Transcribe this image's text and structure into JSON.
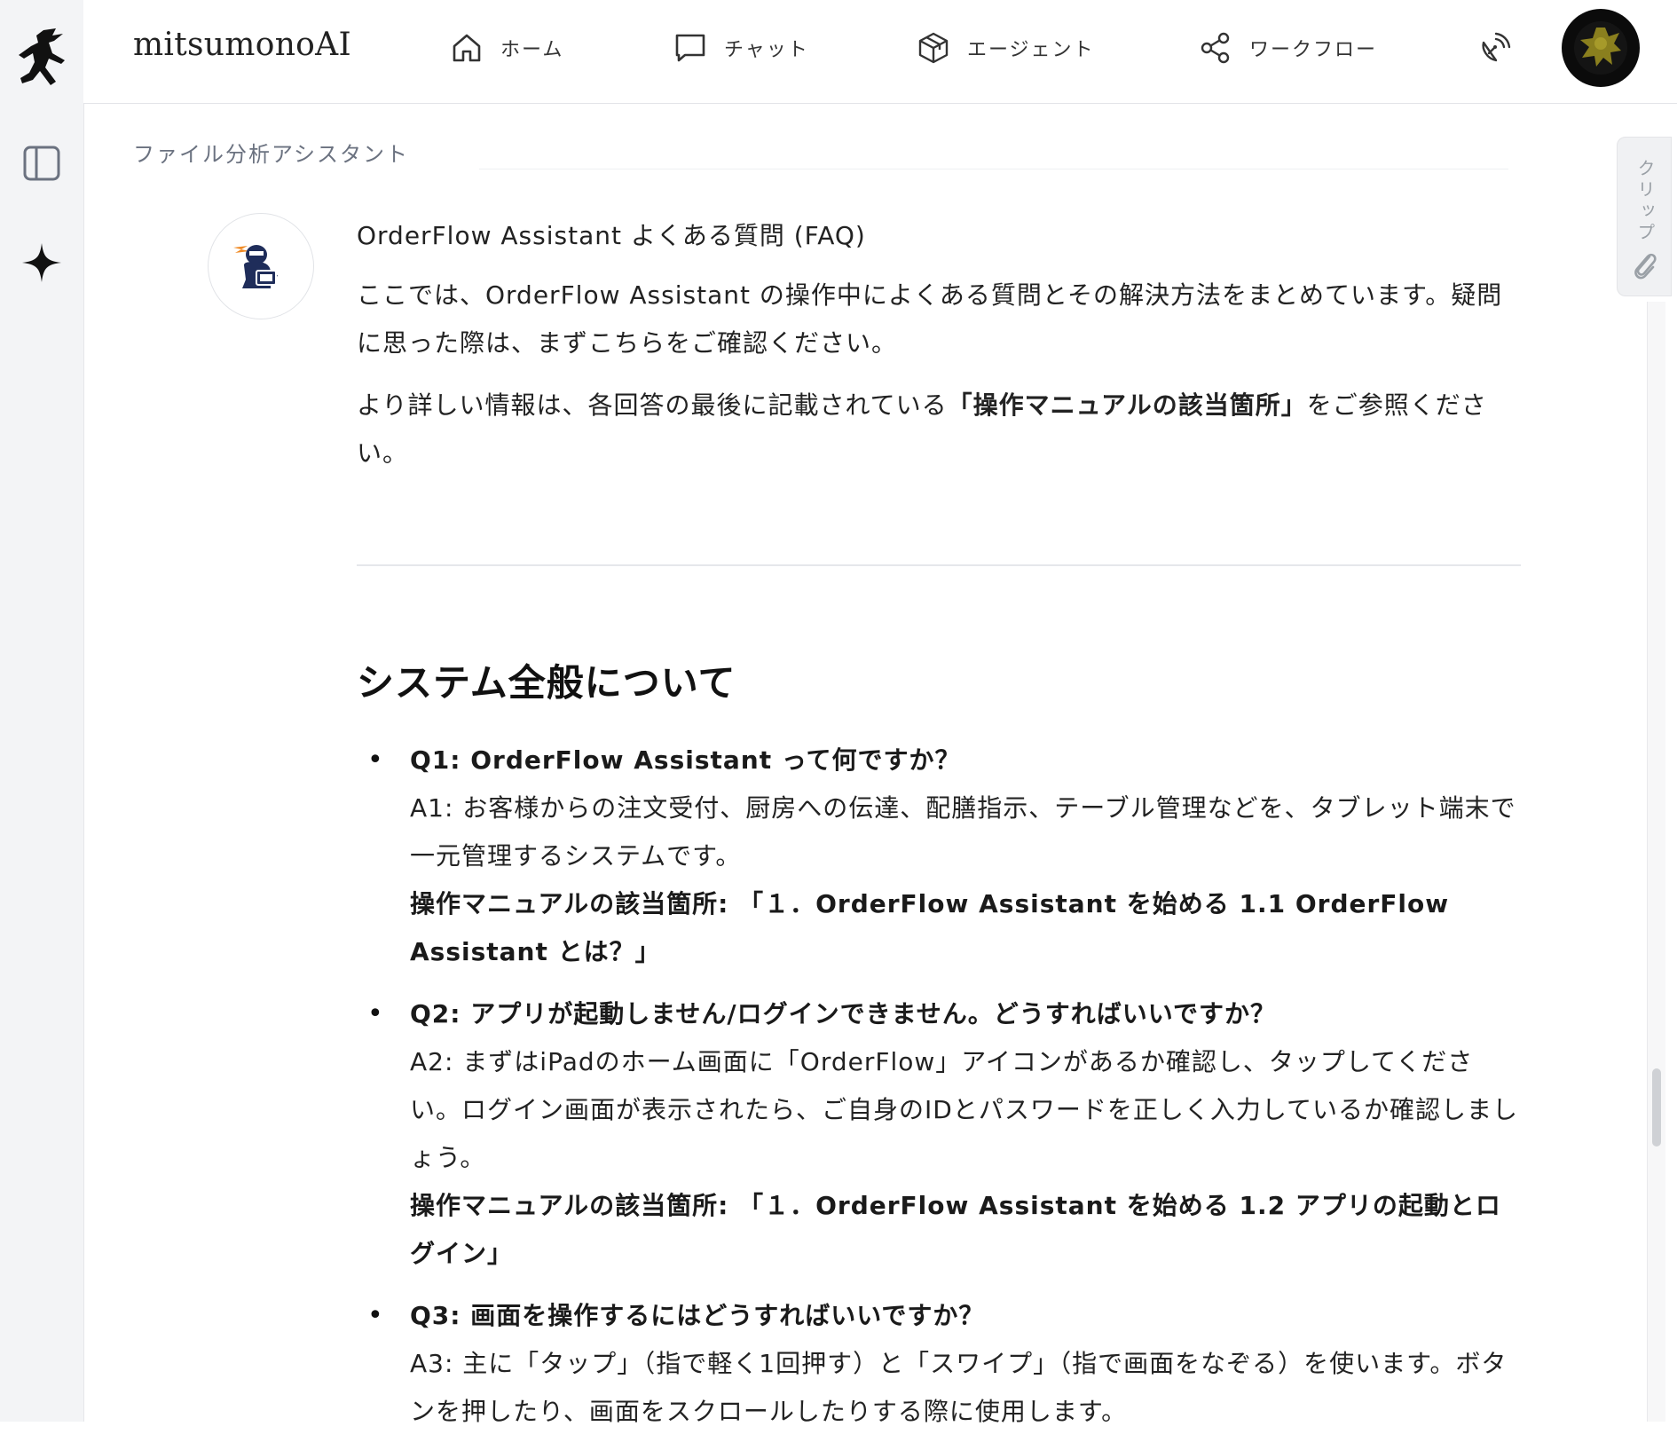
{
  "app": {
    "brand": "mitsumonoAI"
  },
  "nav": [
    {
      "label": "ホーム",
      "icon": "home-icon"
    },
    {
      "label": "チャット",
      "icon": "chat-icon"
    },
    {
      "label": "エージェント",
      "icon": "cube-icon"
    },
    {
      "label": "ワークフロー",
      "icon": "share-nodes-icon"
    }
  ],
  "clip_tab": {
    "label": "クリップ"
  },
  "breadcrumb": "ファイル分析アシスタント",
  "message": {
    "title": "OrderFlow Assistant よくある質問 (FAQ)",
    "intro1": "ここでは、OrderFlow Assistant の操作中によくある質問とその解決方法をまとめています。疑問に思った際は、まずこちらをご確認ください。",
    "intro2_before": "より詳しい情報は、各回答の最後に記載されている",
    "intro2_bold": "「操作マニュアルの該当箇所」",
    "intro2_after": "をご参照ください。"
  },
  "section_heading": "システム全般について",
  "faq": [
    {
      "q": "Q1: OrderFlow Assistant って何ですか？",
      "a": "A1: お客様からの注文受付、厨房への伝達、配膳指示、テーブル管理などを、タブレット端末で一元管理するシステムです。",
      "ref": "操作マニュアルの該当箇所: 「１．OrderFlow Assistant を始める 1.1 OrderFlow Assistant とは？」"
    },
    {
      "q": "Q2: アプリが起動しません/ログインできません。どうすればいいですか？",
      "a": "A2: まずはiPadのホーム画面に「OrderFlow」アイコンがあるか確認し、タップしてください。ログイン画面が表示されたら、ご自身のIDとパスワードを正しく入力しているか確認しましょう。",
      "ref": "操作マニュアルの該当箇所: 「１．OrderFlow Assistant を始める 1.2 アプリの起動とログイン」"
    },
    {
      "q": "Q3: 画面を操作するにはどうすればいいですか？",
      "a": "A3: 主に「タップ」（指で軽く1回押す）と「スワイプ」（指で画面をなぞる）を使います。ボタンを押したり、画面をスクロールしたりする際に使用します。",
      "ref": ""
    }
  ]
}
